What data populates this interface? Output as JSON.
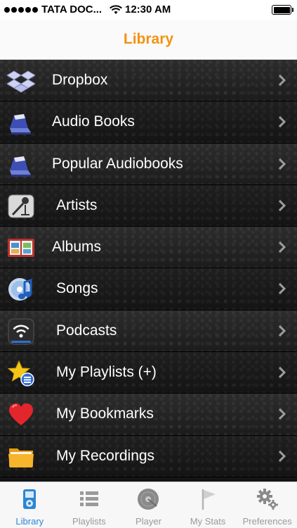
{
  "status_bar": {
    "carrier": "TATA DOC...",
    "time": "12:30 AM"
  },
  "nav": {
    "title": "Library"
  },
  "list": [
    {
      "label": "Dropbox",
      "icon": "dropbox-icon"
    },
    {
      "label": "Audio Books",
      "icon": "audiobook-icon"
    },
    {
      "label": "Popular Audiobooks",
      "icon": "audiobook-icon"
    },
    {
      "label": "Artists",
      "icon": "artist-mic-icon"
    },
    {
      "label": "Albums",
      "icon": "album-icon"
    },
    {
      "label": "Songs",
      "icon": "music-cd-icon"
    },
    {
      "label": "Podcasts",
      "icon": "podcast-wifi-icon"
    },
    {
      "label": "My Playlists (+)",
      "icon": "star-playlist-icon"
    },
    {
      "label": "My Bookmarks",
      "icon": "heart-icon"
    },
    {
      "label": "My Recordings",
      "icon": "folder-icon"
    }
  ],
  "tabs": [
    {
      "label": "Library",
      "icon": "ipod-icon",
      "active": true
    },
    {
      "label": "Playlists",
      "icon": "list-icon",
      "active": false
    },
    {
      "label": "Player",
      "icon": "disc-icon",
      "active": false
    },
    {
      "label": "My Stats",
      "icon": "flag-icon",
      "active": false
    },
    {
      "label": "Preferences",
      "icon": "gear-icon",
      "active": false
    }
  ],
  "colors": {
    "accent": "#f39211",
    "tab_active": "#2d86d3",
    "tab_inactive": "#9a9a9a"
  }
}
